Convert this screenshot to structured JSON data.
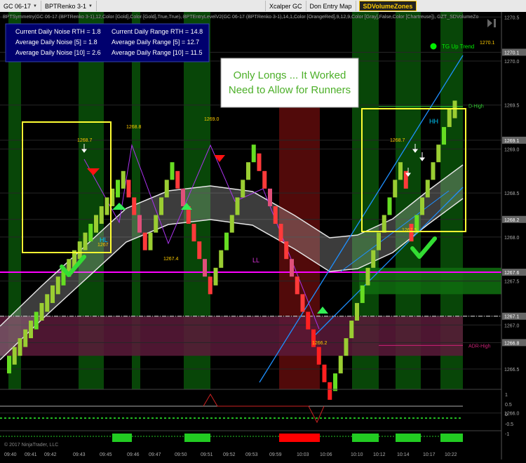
{
  "toolbar": {
    "instrument": "GC 06-17",
    "chart_type": "BPTRenko 3-1",
    "xcalper": "Xcalper GC",
    "don_entry": "Don Entry Map",
    "sd_volume": "SDVolumeZones"
  },
  "indicator_line": "BPTSymmetry(GC 06-17 (BPTRenko 3-1),12,Color [Gold],Color [Gold],True,True), BPTEntryLevelV2(GC 06-17 (BPTRenko 3-1),14,1,Color [OrangeRed],9,12,9,Color [Gray],False,Color [Chartreuse]), GZT_SDVolumeZo",
  "stats": {
    "noise_rth": "Current Daily Noise RTH = 1.8",
    "noise_5": "Average Daily Noise [5] = 1.8",
    "noise_10": "Average Daily Noise [10] = 2.6",
    "range_rth": "Current Daily Range RTH = 14.8",
    "range_5": "Average Daily Range [5] = 12.7",
    "range_10": "Average Daily Range [10] = 11.5"
  },
  "annotation": {
    "line1": "Only Longs ... It Worked",
    "line2": "Need to Allow for Runners"
  },
  "tg_label": "TG Up Trend",
  "copyright": "© 2017 NinjaTrader, LLC",
  "labels": {
    "d_high": "D-High",
    "adr_high": "ADR-High",
    "hl": "HL",
    "hh": "HH",
    "ll": "LL"
  },
  "price_marks": {
    "p1268_7a": "1268.7",
    "p1268_8": "1268.8",
    "p1269_0": "1269.0",
    "p1267_4": "1267.4",
    "p1266_2": "1266.2",
    "p1268_7b": "1268.7",
    "p1270_1": "1270.1",
    "p1267": "1267",
    "p1267_5": "1267.5"
  },
  "colors": {
    "up_bar": "#9acd32",
    "down_bar": "#ff2020",
    "band": "#c0c0c0",
    "magenta_line": "#ff00ff",
    "gold_box": "#ffff33",
    "channel": "#1e90ff",
    "green_zone": "#0b5d0b",
    "purple_zone": "#5a1a3a"
  },
  "chart_data": {
    "type": "renko",
    "y_axis": {
      "min": 1266.0,
      "max": 1270.5,
      "ticks": [
        "1270.5",
        "1270.1",
        "1270.0",
        "1269.5",
        "1269.1",
        "1269.0",
        "1268.5",
        "1268.2",
        "1268.0",
        "1267.6",
        "1267.5",
        "1267.1",
        "1267.0",
        "1266.8",
        "1266.5",
        "1266.0"
      ]
    },
    "y_axis_highlight": [
      "1270.1",
      "1269.1",
      "1268.2",
      "1267.6",
      "1267.1",
      "1266.8"
    ],
    "x_labels": [
      "09:40",
      "09:41",
      "09:42",
      "09:43",
      "09:45",
      "09:46",
      "09:47",
      "09:50",
      "09:51",
      "09:52",
      "09:53",
      "09:59",
      "10:03",
      "10:06",
      "10:10",
      "10:12",
      "10:14",
      "10:17",
      "10:22"
    ],
    "bricks_close": [
      1266.6,
      1266.7,
      1266.8,
      1266.9,
      1267.0,
      1267.1,
      1267.2,
      1267.3,
      1267.4,
      1267.5,
      1267.6,
      1267.7,
      1267.8,
      1267.9,
      1268.0,
      1268.1,
      1268.2,
      1268.3,
      1268.4,
      1268.5,
      1268.6,
      1268.7,
      1268.5,
      1268.3,
      1268.1,
      1267.9,
      1268.0,
      1268.2,
      1268.4,
      1268.6,
      1268.8,
      1268.6,
      1268.4,
      1268.2,
      1268.0,
      1267.8,
      1267.6,
      1267.4,
      1267.6,
      1267.8,
      1268.0,
      1268.2,
      1268.4,
      1268.6,
      1268.8,
      1269.0,
      1268.8,
      1268.6,
      1268.4,
      1268.2,
      1268.0,
      1267.8,
      1267.6,
      1267.4,
      1267.2,
      1267.0,
      1266.8,
      1266.6,
      1266.4,
      1266.2,
      1266.4,
      1266.6,
      1266.8,
      1267.0,
      1267.2,
      1267.4,
      1267.6,
      1267.8,
      1268.0,
      1268.2,
      1268.4,
      1268.6,
      1268.8,
      1268.6,
      1268.0,
      1268.2,
      1268.4,
      1268.6,
      1268.8,
      1269.0,
      1269.2,
      1269.4,
      1269.5
    ],
    "horizontal_levels": {
      "magenta": 1267.6,
      "white_dashdot": 1267.1,
      "d_high": 1269.5,
      "adr_high": 1266.8
    },
    "oscillator_ticks": [
      "1",
      "0.5",
      "0",
      "-0.5",
      "-1"
    ]
  }
}
